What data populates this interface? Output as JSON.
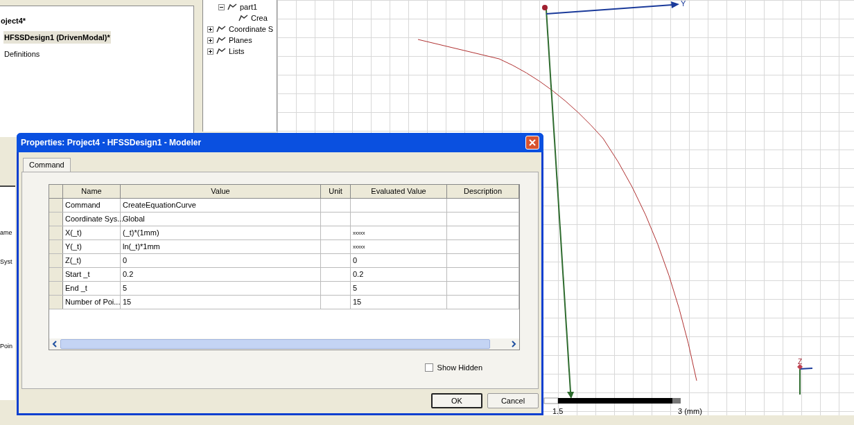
{
  "project_tree": {
    "items": [
      {
        "label": "oject4*",
        "bold": true,
        "selected": false
      },
      {
        "label": "HFSSDesign1 (DrivenModal)*",
        "bold": true,
        "selected": true
      },
      {
        "label": "Definitions",
        "bold": false,
        "selected": false
      }
    ]
  },
  "model_tree": {
    "items": [
      {
        "label": "part1",
        "expanded": true,
        "children": [
          {
            "label": "Crea"
          }
        ]
      },
      {
        "label": "Coordinate S",
        "expanded": false
      },
      {
        "label": "Planes",
        "expanded": false
      },
      {
        "label": "Lists",
        "expanded": false
      }
    ]
  },
  "property_panel_fragments": [
    "ame",
    "Syst",
    "Poin"
  ],
  "viewport": {
    "axis_label": "Y",
    "triad_label": "Z",
    "scale_labels": [
      "1.5",
      "3 (mm)"
    ]
  },
  "dialog": {
    "title": "Properties: Project4 - HFSSDesign1 - Modeler",
    "tabs": [
      {
        "label": "Command",
        "selected": true
      }
    ],
    "table": {
      "columns": [
        "Name",
        "Value",
        "Unit",
        "Evaluated Value",
        "Description"
      ],
      "rows": [
        {
          "cells": [
            "Command",
            "CreateEquationCurve",
            "",
            "",
            ""
          ]
        },
        {
          "cells": [
            "Coordinate Sys...",
            "Global",
            "",
            "",
            ""
          ]
        },
        {
          "cells": [
            "X(_t)",
            "(_t)*(1mm)",
            "",
            "xxxxx",
            ""
          ]
        },
        {
          "cells": [
            "Y(_t)",
            "ln(_t)*1mm",
            "",
            "xxxxx",
            ""
          ]
        },
        {
          "cells": [
            "Z(_t)",
            "0",
            "",
            "0",
            ""
          ]
        },
        {
          "cells": [
            "Start _t",
            "0.2",
            "",
            "0.2",
            ""
          ]
        },
        {
          "cells": [
            "End _t",
            "5",
            "",
            "5",
            ""
          ]
        },
        {
          "cells": [
            "Number of Poi...",
            "15",
            "",
            "15",
            ""
          ]
        }
      ]
    },
    "show_hidden": {
      "label": "Show Hidden",
      "checked": false
    },
    "buttons": [
      {
        "label": "OK",
        "default": true
      },
      {
        "label": "Cancel",
        "default": false
      }
    ]
  }
}
